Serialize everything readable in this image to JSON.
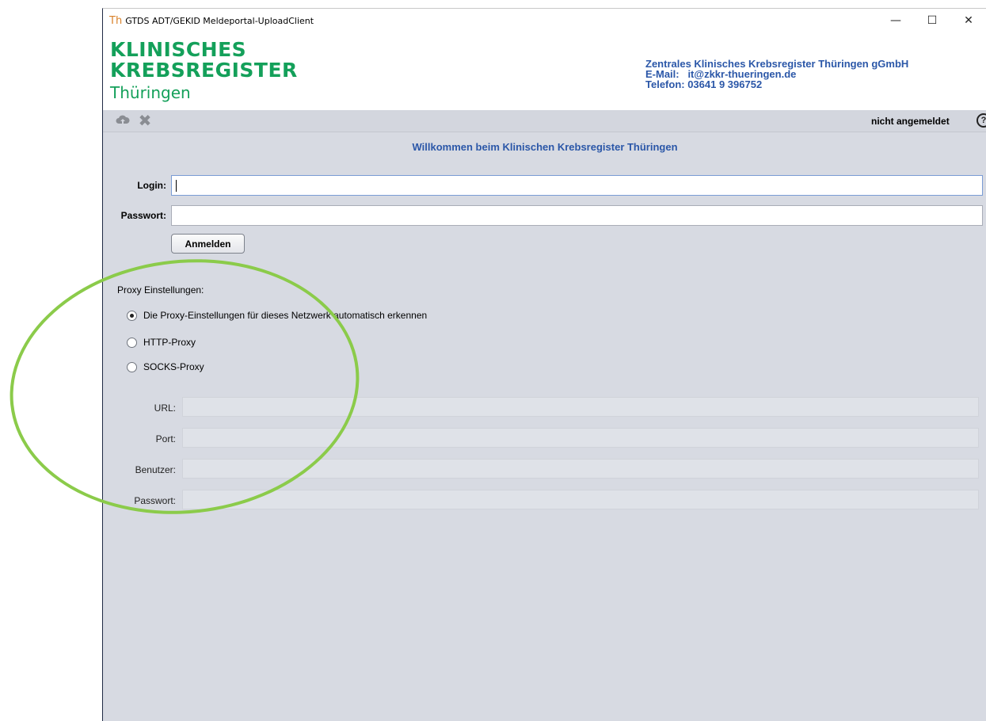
{
  "window": {
    "title_logo": "Th",
    "title": "GTDS ADT/GEKID Meldeportal-UploadClient",
    "controls": {
      "minimize": "—",
      "maximize": "☐",
      "close": "✕"
    }
  },
  "header": {
    "logo_line1": "KLINISCHES",
    "logo_line2": "KREBSREGISTER",
    "logo_line3": "Thüringen",
    "contact_org": "Zentrales Klinisches Krebsregister Thüringen gGmbH",
    "contact_email": "E-Mail:   it@zkkr-thueringen.de",
    "contact_phone": "Telefon: 03641 9 396752"
  },
  "toolbar": {
    "upload_icon": "cloud-upload-icon",
    "close_icon": "close-x-icon",
    "status": "nicht angemeldet",
    "help_icon_glyph": "?"
  },
  "welcome": "Willkommen beim Klinischen Krebsregister Thüringen",
  "login": {
    "login_label": "Login:",
    "login_value": "",
    "password_label": "Passwort:",
    "password_value": "",
    "submit_label": "Anmelden"
  },
  "proxy": {
    "title": "Proxy Einstellungen:",
    "options": [
      {
        "label": "Die Proxy-Einstellungen für dieses Netzwerk automatisch erkennen",
        "checked": true
      },
      {
        "label": "HTTP-Proxy",
        "checked": false
      },
      {
        "label": "SOCKS-Proxy",
        "checked": false
      }
    ],
    "fields": {
      "url_label": "URL:",
      "port_label": "Port:",
      "user_label": "Benutzer:",
      "password_label": "Passwort:"
    }
  },
  "colors": {
    "brand_green": "#14a05a",
    "accent_blue": "#2b57a8",
    "annotation_green": "#8bcb4a"
  }
}
